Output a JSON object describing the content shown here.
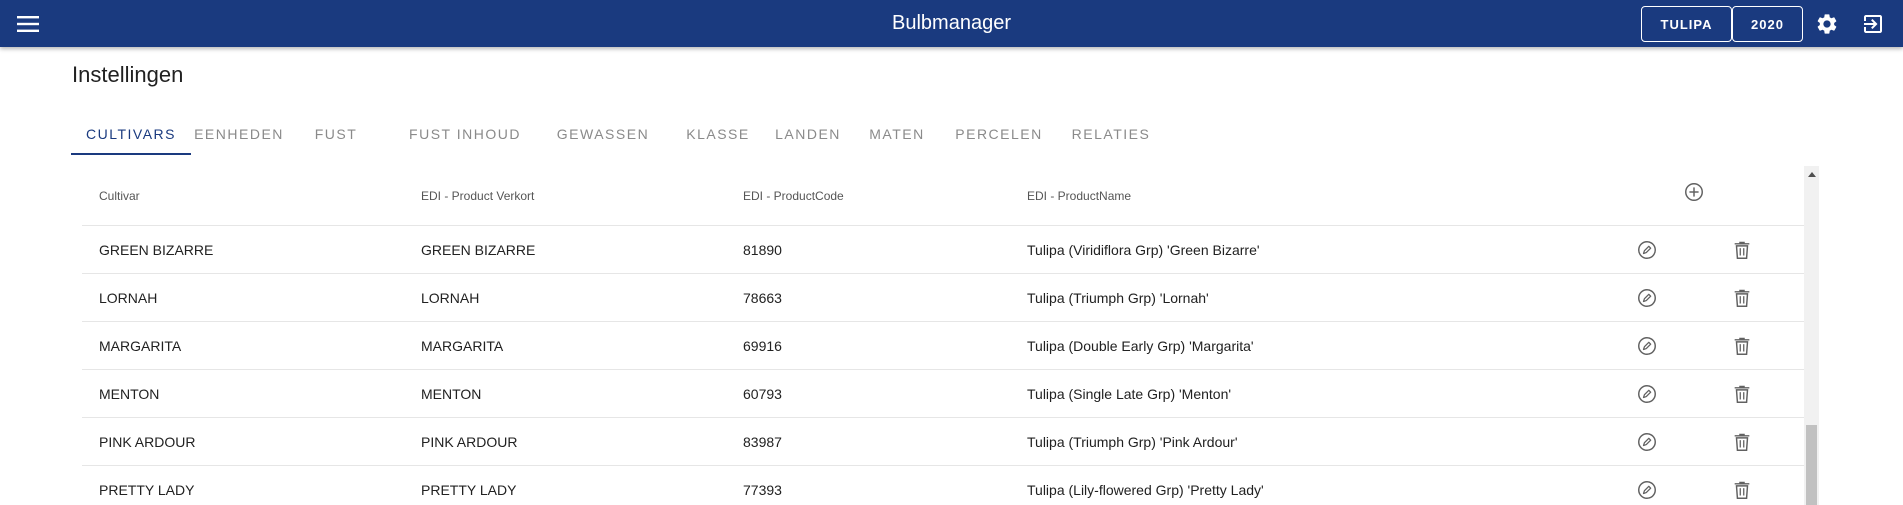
{
  "app": {
    "title": "Bulbmanager",
    "crop_button": "TULIPA",
    "year_button": "2020"
  },
  "page": {
    "title": "Instellingen"
  },
  "tabs": [
    {
      "label": "CULTIVARS",
      "active": true
    },
    {
      "label": "EENHEDEN",
      "active": false
    },
    {
      "label": "FUST",
      "active": false
    },
    {
      "label": "FUST INHOUD",
      "active": false
    },
    {
      "label": "GEWASSEN",
      "active": false
    },
    {
      "label": "KLASSE",
      "active": false
    },
    {
      "label": "LANDEN",
      "active": false
    },
    {
      "label": "MATEN",
      "active": false
    },
    {
      "label": "PERCELEN",
      "active": false
    },
    {
      "label": "RELATIES",
      "active": false
    }
  ],
  "table": {
    "columns": [
      "Cultivar",
      "EDI - Product Verkort",
      "EDI - ProductCode",
      "EDI - ProductName"
    ],
    "rows": [
      {
        "cultivar": "GREEN BIZARRE",
        "verkort": "GREEN BIZARRE",
        "code": "81890",
        "name": "Tulipa (Viridiflora Grp) 'Green Bizarre'"
      },
      {
        "cultivar": "LORNAH",
        "verkort": "LORNAH",
        "code": "78663",
        "name": "Tulipa (Triumph Grp) 'Lornah'"
      },
      {
        "cultivar": "MARGARITA",
        "verkort": "MARGARITA",
        "code": "69916",
        "name": "Tulipa (Double Early Grp) 'Margarita'"
      },
      {
        "cultivar": "MENTON",
        "verkort": "MENTON",
        "code": "60793",
        "name": "Tulipa (Single Late Grp) 'Menton'"
      },
      {
        "cultivar": "PINK ARDOUR",
        "verkort": "PINK ARDOUR",
        "code": "83987",
        "name": "Tulipa (Triumph Grp) 'Pink Ardour'"
      },
      {
        "cultivar": "PRETTY LADY",
        "verkort": "PRETTY LADY",
        "code": "77393",
        "name": "Tulipa (Lily-flowered Grp) 'Pretty Lady'"
      }
    ]
  },
  "icons": {
    "menu": "menu-icon",
    "settings": "gear-icon",
    "logout": "logout-icon",
    "add": "add-circle-icon",
    "edit": "edit-icon",
    "delete": "trash-icon"
  },
  "colors": {
    "primary": "#1a3a7f",
    "tab_inactive": "#8a8a8a",
    "divider": "#e6e6e6"
  }
}
